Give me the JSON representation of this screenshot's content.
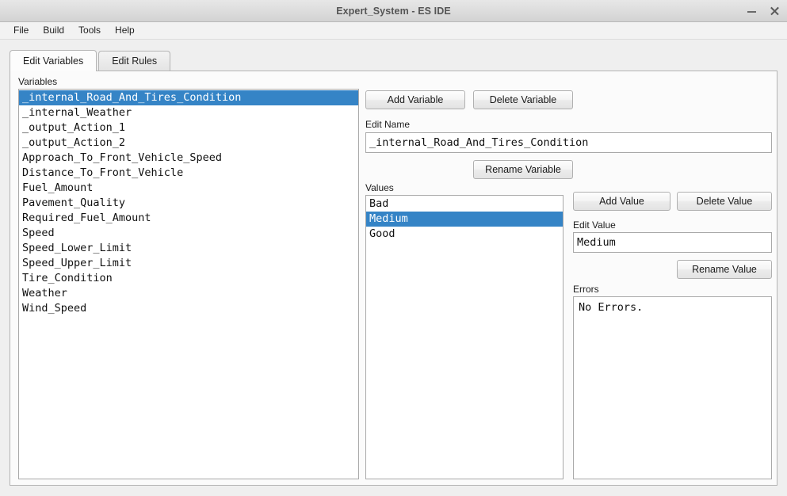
{
  "window": {
    "title": "Expert_System - ES IDE",
    "controls": [
      {
        "name": "minimize",
        "label": "–"
      },
      {
        "name": "close",
        "label": "×"
      }
    ]
  },
  "menubar": {
    "items": [
      {
        "label": "File"
      },
      {
        "label": "Build"
      },
      {
        "label": "Tools"
      },
      {
        "label": "Help"
      }
    ]
  },
  "tabs": [
    {
      "label": "Edit Variables",
      "active": true
    },
    {
      "label": "Edit Rules",
      "active": false
    }
  ],
  "variables_panel": {
    "label": "Variables",
    "selected_index": 0,
    "items": [
      "_internal_Road_And_Tires_Condition",
      "_internal_Weather",
      "_output_Action_1",
      "_output_Action_2",
      "Approach_To_Front_Vehicle_Speed",
      "Distance_To_Front_Vehicle",
      "Fuel_Amount",
      "Pavement_Quality",
      "Required_Fuel_Amount",
      "Speed",
      "Speed_Lower_Limit",
      "Speed_Upper_Limit",
      "Tire_Condition",
      "Weather",
      "Wind_Speed"
    ]
  },
  "variable_actions": {
    "add_label": "Add Variable",
    "delete_label": "Delete Variable",
    "rename_label": "Rename Variable",
    "edit_name_label": "Edit Name",
    "edit_name_value": "_internal_Road_And_Tires_Condition"
  },
  "values_panel": {
    "label": "Values",
    "selected_index": 1,
    "items": [
      "Bad",
      "Medium",
      "Good"
    ]
  },
  "value_actions": {
    "add_label": "Add Value",
    "delete_label": "Delete Value",
    "rename_label": "Rename Value",
    "edit_value_label": "Edit Value",
    "edit_value_value": "Medium"
  },
  "errors_panel": {
    "label": "Errors",
    "text": "No Errors."
  },
  "colors": {
    "selection": "#3584c6",
    "selection_text": "#ffffff",
    "window_bg": "#efefef",
    "panel_bg": "#fbfbfb",
    "field_bg": "#ffffff",
    "border": "#a9a9a9"
  }
}
